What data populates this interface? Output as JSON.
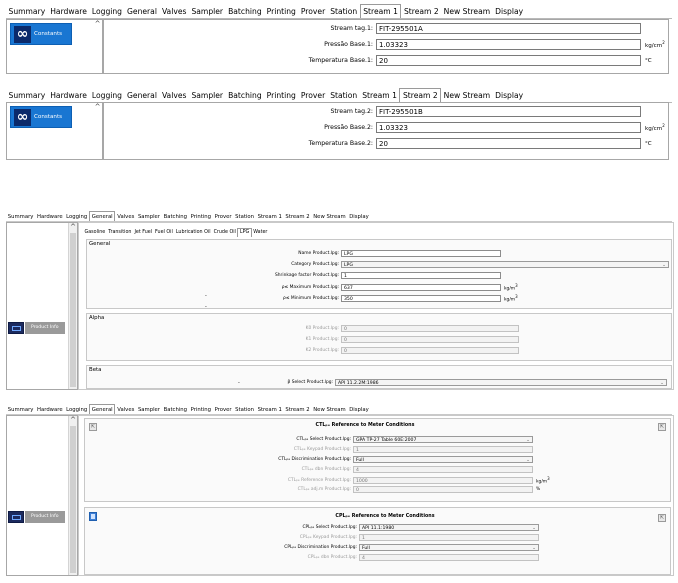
{
  "tabs": [
    "Summary",
    "Hardware",
    "Logging",
    "General",
    "Valves",
    "Sampler",
    "Batching",
    "Printing",
    "Prover",
    "Station",
    "Stream 1",
    "Stream 2",
    "New Stream",
    "Display"
  ],
  "constants_label": "Constants",
  "stream1": {
    "active_tab": "Stream 1",
    "fields": [
      {
        "label": "Stream tag.1:",
        "value": "FIT-295501A",
        "unit": ""
      },
      {
        "label": "Pressão Base.1:",
        "value": "1.03323",
        "unit": "kg/cm",
        "sup": "2"
      },
      {
        "label": "Temperatura Base.1:",
        "value": "20",
        "unit": "°C",
        "sup": ""
      }
    ]
  },
  "stream2": {
    "active_tab": "Stream 2",
    "fields": [
      {
        "label": "Stream tag.2:",
        "value": "FIT-295501B",
        "unit": ""
      },
      {
        "label": "Pressão Base.2:",
        "value": "1.03323",
        "unit": "kg/cm",
        "sup": "2"
      },
      {
        "label": "Temperatura Base.2:",
        "value": "20",
        "unit": "°C",
        "sup": ""
      }
    ]
  },
  "general": {
    "active_tab": "General",
    "product_tabs": [
      "Gasoline",
      "Transition",
      "Jet Fuel",
      "Fuel Oil",
      "Lubrication Oil",
      "Crude Oil",
      "LPG",
      "Water"
    ],
    "active_product": "LPG",
    "product_button": "Product Info",
    "group_general": {
      "title": "General",
      "rows": [
        {
          "label": "Name Product.lpg:",
          "value": "LPG",
          "type": "input"
        },
        {
          "label": "Category Product.lpg:",
          "value": "LPG",
          "type": "select"
        },
        {
          "label": "Shrinkage factor Product.lpg:",
          "value": "1",
          "type": "input"
        },
        {
          "label": "ρ≤ Maximum Product.lpg:",
          "value": "637",
          "type": "input",
          "unit": "kg/m",
          "sup": "3"
        },
        {
          "label": "ρ≤ Minimum Product.lpg:",
          "value": "350",
          "type": "input",
          "unit": "kg/m",
          "sup": "3"
        }
      ],
      "dashes": [
        "-",
        "-"
      ]
    },
    "group_alpha": {
      "title": "Alpha",
      "rows": [
        {
          "label": "K0 Product.lpg:",
          "value": "0"
        },
        {
          "label": "K1 Product.lpg:",
          "value": "0"
        },
        {
          "label": "K2 Product.lpg:",
          "value": "0"
        }
      ]
    },
    "group_beta": {
      "title": "Beta",
      "dash": "-",
      "row": {
        "label": "β Select Product.lpg:",
        "value": "API 11.2.2M:1986"
      }
    }
  },
  "ctl": {
    "active_tab": "General",
    "product_button": "Product Info",
    "ctl_title": "CTLₚₑ Reference to Meter Conditions",
    "ctl_rows": [
      {
        "label": "CTLₚₑ Select Product.lpg:",
        "value": "GPA TP-27 Table 60E:2007",
        "type": "select",
        "dis": false
      },
      {
        "label": "CTLₚₑ Keypad Product.lpg:",
        "value": "1",
        "type": "input",
        "dis": true
      },
      {
        "label": "CTLₚₑ Discrimination Product.lpg:",
        "value": "Full",
        "type": "select",
        "dis": false
      },
      {
        "label": "CTLₚₑ dbn Product.lpg:",
        "value": "4",
        "type": "input",
        "dis": true
      },
      {
        "label": "CTLₚₑ Reference Product.lpg:",
        "value": "1000",
        "type": "input",
        "dis": true,
        "unit": "kg/m",
        "sup": "3"
      },
      {
        "label": "CTLₚₑ adj.m Product.lpg:",
        "value": "0",
        "type": "input",
        "dis": true,
        "unit": "%"
      }
    ],
    "cpl_title": "CPLₚₑ Reference to Meter Conditions",
    "cpl_rows": [
      {
        "label": "CPLₚₑ Select Product.lpg:",
        "value": "API 11.1:1980",
        "type": "select",
        "dis": false
      },
      {
        "label": "CPLₚₑ Keypad Product.lpg:",
        "value": "1",
        "type": "input",
        "dis": true
      },
      {
        "label": "CPLₚₑ Discrimination Product.lpg:",
        "value": "Full",
        "type": "select",
        "dis": false
      },
      {
        "label": "CPLₚₑ dbn Product.lpg:",
        "value": "4",
        "type": "input",
        "dis": true
      }
    ]
  }
}
